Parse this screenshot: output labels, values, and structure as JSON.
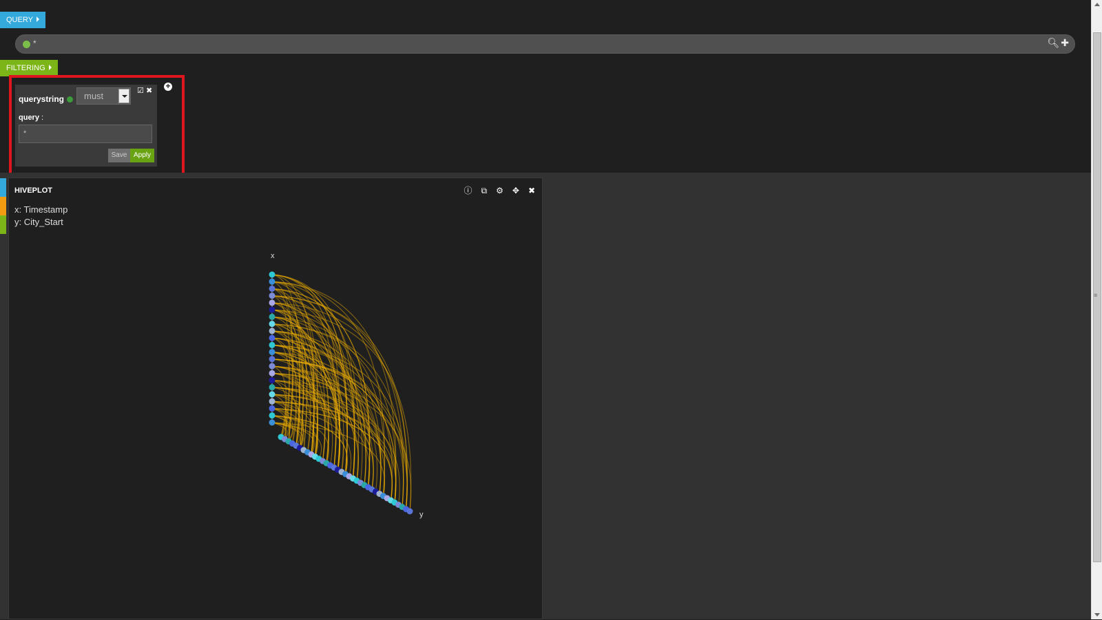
{
  "query_tab": {
    "label": "QUERY"
  },
  "search": {
    "value": "*"
  },
  "filtering_tab": {
    "label": "FILTERING"
  },
  "filter_card": {
    "type": "querystring",
    "mode": "must",
    "query_label": "query",
    "query_value": "*",
    "save_label": "Save",
    "apply_label": "Apply"
  },
  "panel": {
    "title": "HIVEPLOT",
    "x_info": "x: Timestamp",
    "y_info": "y: City_Start"
  },
  "chart_data": {
    "type": "hiveplot",
    "axes": [
      {
        "name": "x",
        "field": "Timestamp",
        "node_count": 22
      },
      {
        "name": "y",
        "field": "City_Start",
        "node_count": 35
      }
    ],
    "link_color": "#f0b000",
    "node_colors": [
      "#2ec7d4",
      "#3a8fd8",
      "#5a74d8",
      "#7b8bd8",
      "#a9a9e8",
      "#1c1c9a",
      "#2aa7a7",
      "#66d9e8",
      "#9fb3d0",
      "#4a66e0"
    ]
  },
  "colors": {
    "query": "#33a9dc",
    "filtering": "#7cb518",
    "apply": "#6aa312",
    "highlight": "#e0161e"
  }
}
